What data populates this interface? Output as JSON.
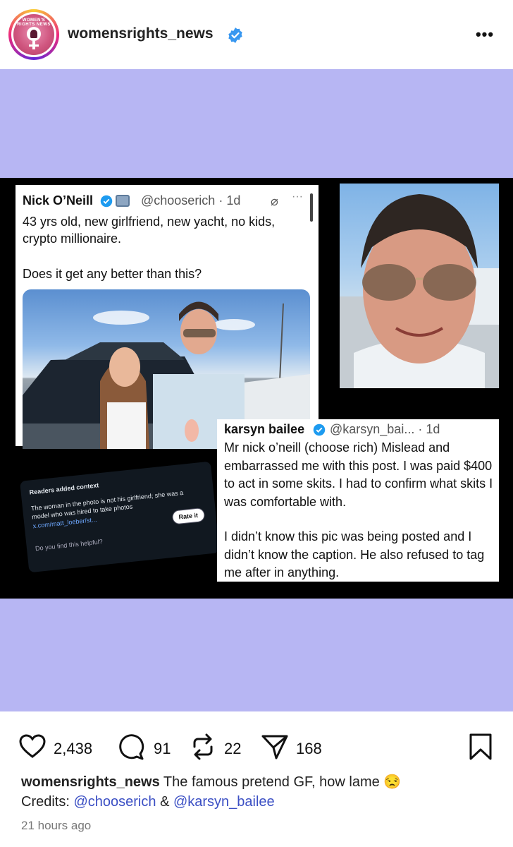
{
  "post": {
    "username": "womensrights_news",
    "avatar_label": "WOMEN'S RIGHTS NEWS",
    "more_label": "•••"
  },
  "image": {
    "tweet1": {
      "name": "Nick O’Neill",
      "handle": "@chooserich · 1d",
      "text": "43 yrs old, new girlfriend, new yacht, no kids, crypto millionaire.",
      "text2": "Does it get any better than this?"
    },
    "tweet2": {
      "name": "karsyn bailee",
      "handle": "@karsyn_bai... · 1d",
      "text": "Mr nick o’neill (choose rich) Mislead and embarrassed me with this post. I was paid $400 to act in some skits. I had to confirm what skits I was comfortable with.",
      "text2": "I didn’t know this pic was being posted and I didn’t know the caption. He also refused to tag me after in anything."
    },
    "context": {
      "title": "Readers added context",
      "text": "The woman in the photo is not his girlfriend; she was a model who was hired to take photos",
      "link": "x.com/matt_loeber/st...",
      "rate": "Rate it",
      "helpful": "Do you find this helpful?"
    }
  },
  "actions": {
    "likes": "2,438",
    "comments": "91",
    "reposts": "22",
    "shares": "168"
  },
  "caption": {
    "username": "womensrights_news",
    "text": "The famous pretend GF, how lame 😒",
    "credits_label": "Credits:",
    "mention1": "@chooserich",
    "amp": "&",
    "mention2": "@karsyn_bailee",
    "time": "21 hours ago"
  },
  "colors": {
    "media_bg": "#b7b6f3",
    "verified": "#3797f0",
    "mention": "#3b4fc4"
  }
}
